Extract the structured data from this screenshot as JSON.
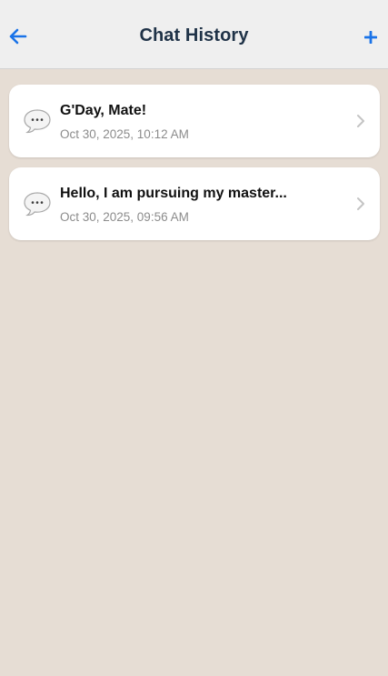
{
  "header": {
    "title": "Chat History",
    "back_icon": "arrow-left-icon",
    "add_icon": "plus-icon",
    "accent_color": "#1a73e8"
  },
  "chats": [
    {
      "title": "G'Day, Mate!",
      "date": "Oct 30, 2025, 10:12 AM",
      "icon": "speech-bubble-icon"
    },
    {
      "title": "Hello, I am pursuing my master...",
      "date": "Oct 30, 2025, 09:56 AM",
      "icon": "speech-bubble-icon"
    }
  ],
  "colors": {
    "background": "#e6ddd4",
    "header_background": "#efefef",
    "title_color": "#1f3247",
    "date_color": "#8c8c8c"
  }
}
